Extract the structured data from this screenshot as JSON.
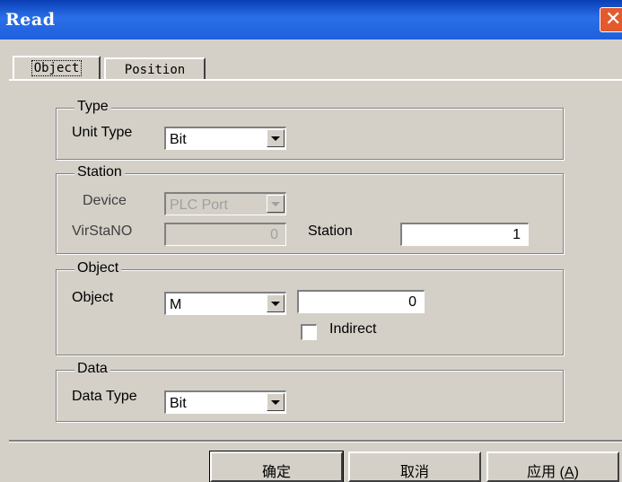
{
  "window": {
    "title": "Read",
    "close_glyph": "✕"
  },
  "tabs": [
    {
      "label": "Object"
    },
    {
      "label": "Position"
    }
  ],
  "type_group": {
    "legend": "Type",
    "unit_type_label": "Unit Type",
    "unit_type_value": "Bit"
  },
  "station_group": {
    "legend": "Station",
    "device_label": "Device",
    "device_value": "PLC Port",
    "virsta_label": "VirStaNO",
    "virsta_value": "0",
    "station_label": "Station",
    "station_value": "1"
  },
  "object_group": {
    "legend": "Object",
    "object_label": "Object",
    "object_value": "M",
    "address_value": "0",
    "indirect_label": "Indirect"
  },
  "data_group": {
    "legend": "Data",
    "data_type_label": "Data Type",
    "data_type_value": "Bit"
  },
  "buttons": {
    "ok": "确定",
    "cancel": "取消",
    "apply_prefix": "应用 (",
    "apply_key": "A",
    "apply_suffix": ")"
  },
  "colors": {
    "titlebar": "#1f5fdb",
    "face": "#d4d0c8",
    "close": "#e25a2e"
  }
}
